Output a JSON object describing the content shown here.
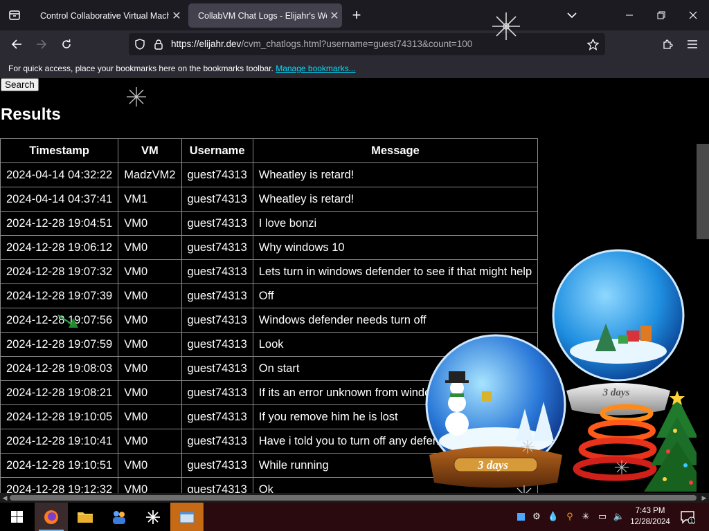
{
  "tabs": [
    {
      "title": "Control Collaborative Virtual Machi",
      "active": false
    },
    {
      "title": "CollabVM Chat Logs - Elijahr's Web",
      "active": true
    }
  ],
  "url": {
    "host": "https://elijahr.dev",
    "path": "/cvm_chatlogs.html?username=guest74313&count=100"
  },
  "bookmarks": {
    "text": "For quick access, place your bookmarks here on the bookmarks toolbar.",
    "link": "Manage bookmarks..."
  },
  "page": {
    "search_label": "Search",
    "results_heading": "Results"
  },
  "table": {
    "headers": [
      "Timestamp",
      "VM",
      "Username",
      "Message"
    ],
    "rows": [
      [
        "2024-04-14 04:32:22",
        "MadzVM2",
        "guest74313",
        "Wheatley is retard!"
      ],
      [
        "2024-04-14 04:37:41",
        "VM1",
        "guest74313",
        "Wheatley is retard!"
      ],
      [
        "2024-12-28 19:04:51",
        "VM0",
        "guest74313",
        "I love bonzi"
      ],
      [
        "2024-12-28 19:06:12",
        "VM0",
        "guest74313",
        "Why windows 10"
      ],
      [
        "2024-12-28 19:07:32",
        "VM0",
        "guest74313",
        "Lets turn in windows defender to see if that might help"
      ],
      [
        "2024-12-28 19:07:39",
        "VM0",
        "guest74313",
        "Off"
      ],
      [
        "2024-12-28 19:07:56",
        "VM0",
        "guest74313",
        "Windows defender needs turn off"
      ],
      [
        "2024-12-28 19:07:59",
        "VM0",
        "guest74313",
        "Look"
      ],
      [
        "2024-12-28 19:08:03",
        "VM0",
        "guest74313",
        "On start"
      ],
      [
        "2024-12-28 19:08:21",
        "VM0",
        "guest74313",
        "If its an error unknown from window"
      ],
      [
        "2024-12-28 19:10:05",
        "VM0",
        "guest74313",
        "If you remove him he is lost"
      ],
      [
        "2024-12-28 19:10:41",
        "VM0",
        "guest74313",
        "Have i told you to turn off any defende"
      ],
      [
        "2024-12-28 19:10:51",
        "VM0",
        "guest74313",
        "While running"
      ],
      [
        "2024-12-28 19:12:32",
        "VM0",
        "guest74313",
        "Ok"
      ]
    ]
  },
  "decorations": {
    "globe_right_label": "3 days",
    "globe_left_label": "3 days"
  },
  "taskbar": {
    "time": "7:43 PM",
    "date": "12/28/2024",
    "notification_count": "1"
  },
  "icons": {
    "tab_list": "tab-list-icon",
    "back": "back-arrow-icon",
    "forward": "forward-arrow-icon",
    "reload": "reload-icon",
    "shield": "tracking-shield-icon",
    "lock": "lock-icon",
    "bookmark_star": "bookmark-star-icon",
    "extensions": "extensions-icon",
    "menu": "hamburger-menu-icon"
  },
  "colors": {
    "tabbar": "#1c1b22",
    "toolbar": "#2b2a33",
    "active_tab": "#42414d",
    "link": "#00ddff",
    "page_bg": "#000000"
  }
}
